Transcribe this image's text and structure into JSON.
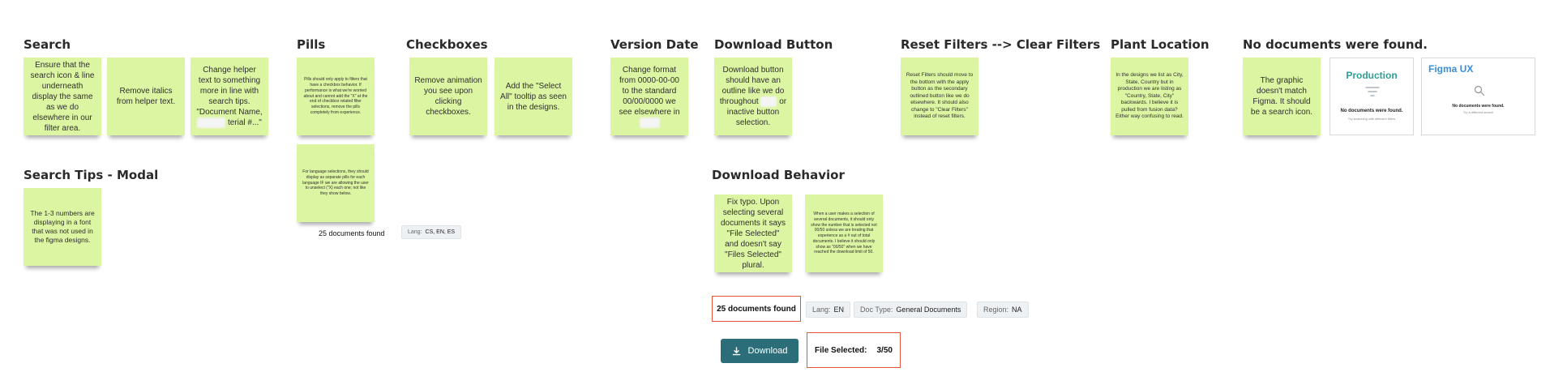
{
  "headings": {
    "search": "Search",
    "pills": "Pills",
    "checkboxes": "Checkboxes",
    "version_date": "Version Date",
    "download_button": "Download Button",
    "reset_filters": "Reset Filters --> Clear Filters",
    "plant_location": "Plant Location",
    "no_documents": "No documents were found.",
    "search_tips": "Search Tips - Modal",
    "download_behavior": "Download Behavior"
  },
  "notes": {
    "search_1": "Ensure that the search icon & line underneath display the same as we do elsewhere in our filter area.",
    "search_2": "Remove italics from helper text.",
    "search_3_a": "Change helper text to something more in line with search tips. \"Document Name,",
    "search_3_b": "terial #...\"",
    "pills_1": "Pills should only apply to filters that have a checkbox behavior. If performance is what we're worried about and cannot add the \"X\" at the end of checkbox related filter selections, remove the pills completely from experience.",
    "pills_2": "For language selections, they should display as separate pills for each language IF we are allowing the user to unselect (\"X) each one; not like they show below.",
    "checkboxes_1": "Remove animation you see upon clicking checkboxes.",
    "checkboxes_2": "Add the \"Select All\" tooltip as seen in the designs.",
    "version_date_1": "Change format from 0000-00-00 to the standard 00/00/0000 we see elsewhere in",
    "download_button_a": "Download button should have an outline like we do throughout",
    "download_button_b": "or inactive button selection.",
    "reset_filters_1": "Reset Filters should move to the bottom with the apply button as the secondary outlined button like we do elsewhere. It should also change to \"Clear Filters\" instead of reset filters.",
    "plant_location_1": "In the designs we list as City, State, Country but in production we are listing as \"Country, State, City\" backwards. I believe it is pulled from fusion data? Either way confusing to read.",
    "no_documents_1": "The graphic doesn't match Figma. It should be a search icon.",
    "search_tips_1": "The 1-3 numbers are displaying in a font that was not used in the figma designs.",
    "download_behavior_1": "Fix typo. Upon selecting several documents it says \"File Selected\" and doesn't say \"Files Selected\" plural.",
    "download_behavior_2": "When a user makes a selection of several documents, it should only show the number that is selected not 00/50 unless we are treating that experience as a # out of total documents. I believe it should only show as \"00/50\" when we have reached the download limit of 50."
  },
  "cards": {
    "production_title": "Production",
    "production_message": "No documents were found.",
    "production_sub": "Try searching with different filters",
    "figma_title": "Figma UX",
    "figma_message": "No documents were found.",
    "figma_sub": "Try a different search"
  },
  "pills_example": {
    "count": "25 documents found",
    "lang_label": "Lang:",
    "lang_value": "CS, EN, ES"
  },
  "download_example": {
    "count": "25 documents found",
    "tags": [
      {
        "label": "Lang:",
        "value": "EN"
      },
      {
        "label": "Doc Type:",
        "value": "General Documents"
      },
      {
        "label": "Region:",
        "value": "NA"
      }
    ],
    "button_label": "Download",
    "file_selected_label": "File Selected:",
    "file_selected_value": "3/50"
  },
  "colors": {
    "sticky": "#dcf5a2",
    "accent_teal": "#2b6d78",
    "highlight_red": "#e5533c",
    "production_green": "#2e9f94",
    "figma_blue": "#3a8fd6"
  },
  "icons": [
    "download-icon",
    "filter-lines-icon",
    "search-icon"
  ]
}
